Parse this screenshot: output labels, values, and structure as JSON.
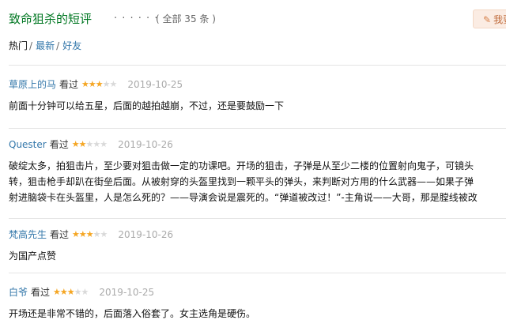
{
  "header": {
    "title": "致命狙杀的短评",
    "dots": "· · · · · ·",
    "count": "( 全部 35 条 )",
    "write_label": "我要写"
  },
  "tabs": [
    {
      "label": "热门",
      "sep": "/"
    },
    {
      "label": "最新",
      "sep": "/"
    },
    {
      "label": "好友",
      "sep": ""
    }
  ],
  "reviews": [
    {
      "user": "草原上的马",
      "watched": "看过",
      "rating": 3,
      "date": "2019-10-25",
      "lines": [
        "前面十分钟可以给五星，后面的越拍越崩，不过，还是要鼓励一下"
      ]
    },
    {
      "user": "Quester",
      "watched": "看过",
      "rating": 2,
      "date": "2019-10-26",
      "lines": [
        "破绽太多，拍狙击片，至少要对狙击做一定的功课吧。开场的狙击，子弹是从至少二楼的位置射向鬼子，可镜头",
        "转，狙击枪手却趴在街垒后面。从被射穿的头盔里找到一颗平头的弹头，来判断对方用的什么武器——如果子弹",
        "射进脑袋卡在头盔里，人是怎么死的？——导演会说是震死的。“弹道被改过！”-主角说——大哥，那是膛线被改"
      ]
    },
    {
      "user": "梵高先生",
      "watched": "看过",
      "rating": 3,
      "date": "2019-10-26",
      "lines": [
        "为国产点赞"
      ]
    },
    {
      "user": "白爷",
      "watched": "看过",
      "rating": 3,
      "date": "2019-10-25",
      "lines": [
        "开场还是非常不错的，后面落入俗套了。女主选角是硬伤。"
      ]
    }
  ]
}
